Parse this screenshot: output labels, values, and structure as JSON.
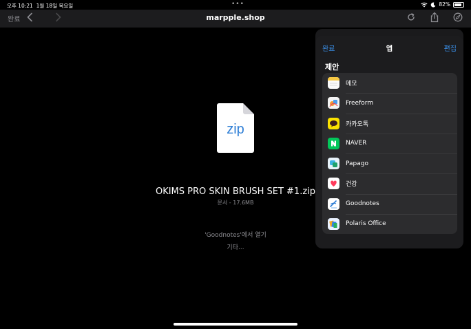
{
  "status_bar": {
    "time": "오후 10:21",
    "date": "1월 18일 목요일",
    "dots": "•••",
    "battery": "82%",
    "battery_level": 0.82
  },
  "nav": {
    "done": "완료",
    "title": "marpple.shop"
  },
  "file": {
    "icon_label": "zip",
    "name": "OKIMS PRO SKIN BRUSH SET #1.zip",
    "info": "문서 - 17.6MB",
    "open_in": "'Goodnotes'에서 열기",
    "more": "기타..."
  },
  "share_sheet": {
    "done": "완료",
    "title": "앱",
    "edit": "편집",
    "section": "제안",
    "apps": [
      {
        "label": "메모",
        "icon": "notes-icon"
      },
      {
        "label": "Freeform",
        "icon": "freeform-icon"
      },
      {
        "label": "카카오톡",
        "icon": "kakaotalk-icon"
      },
      {
        "label": "NAVER",
        "icon": "naver-icon"
      },
      {
        "label": "Papago",
        "icon": "papago-icon"
      },
      {
        "label": "건강",
        "icon": "health-icon"
      },
      {
        "label": "Goodnotes",
        "icon": "goodnotes-icon"
      },
      {
        "label": "Polaris Office",
        "icon": "polaris-office-icon"
      }
    ]
  },
  "colors": {
    "accent": "#3a8ee6",
    "background": "#000000",
    "sheet": "#1c1c1e",
    "list": "#2c2c2e",
    "secondary_text": "#8e8e93"
  }
}
